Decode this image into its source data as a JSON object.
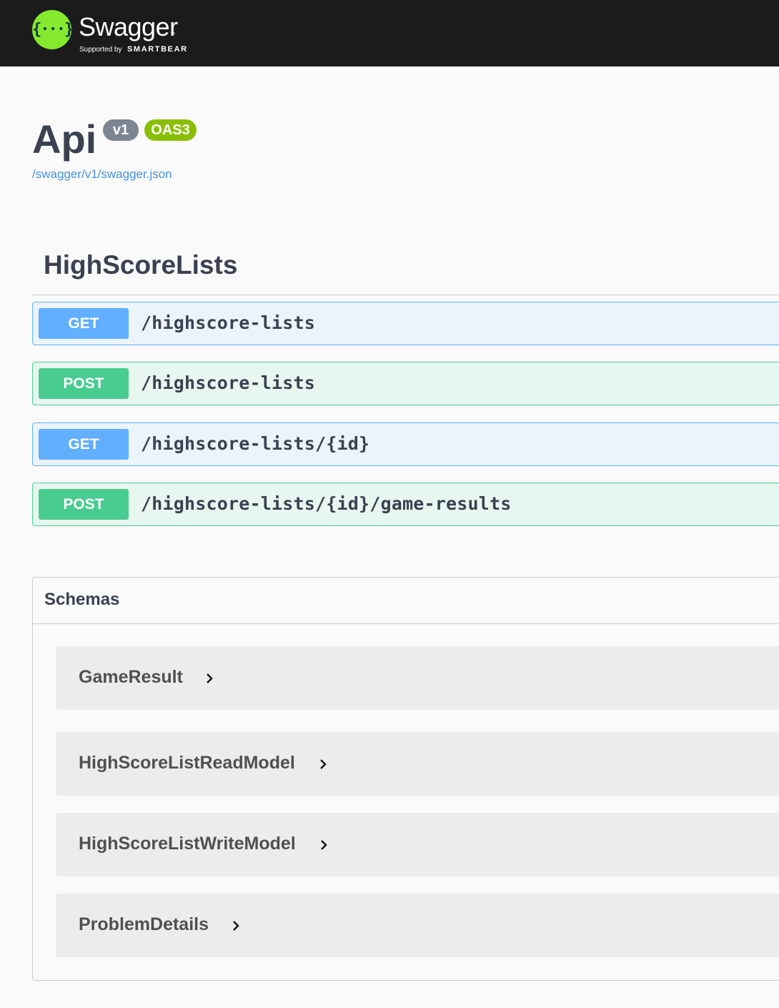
{
  "header": {
    "logo_glyph": "{···}",
    "title": "Swagger",
    "trademark": "™",
    "supported_by": "Supported by",
    "brand": "SMARTBEAR"
  },
  "info": {
    "title": "Api",
    "version": "v1",
    "spec_badge": "OAS3",
    "spec_link": "/swagger/v1/swagger.json"
  },
  "tag": {
    "name": "HighScoreLists"
  },
  "operations": [
    {
      "method": "GET",
      "path": "/highscore-lists"
    },
    {
      "method": "POST",
      "path": "/highscore-lists"
    },
    {
      "method": "GET",
      "path": "/highscore-lists/{id}"
    },
    {
      "method": "POST",
      "path": "/highscore-lists/{id}/game-results"
    }
  ],
  "schemas": {
    "title": "Schemas",
    "models": [
      {
        "name": "GameResult"
      },
      {
        "name": "HighScoreListReadModel"
      },
      {
        "name": "HighScoreListWriteModel"
      },
      {
        "name": "ProblemDetails"
      }
    ]
  },
  "colors": {
    "topbar": "#1b1b1b",
    "logo_green": "#85ea2d",
    "get": "#61affe",
    "post": "#49cc90",
    "link": "#4990e2",
    "version_badge": "#7d8492",
    "oas_badge": "#89bf04"
  },
  "icons": {
    "model_expand": "chevron-right-icon"
  }
}
